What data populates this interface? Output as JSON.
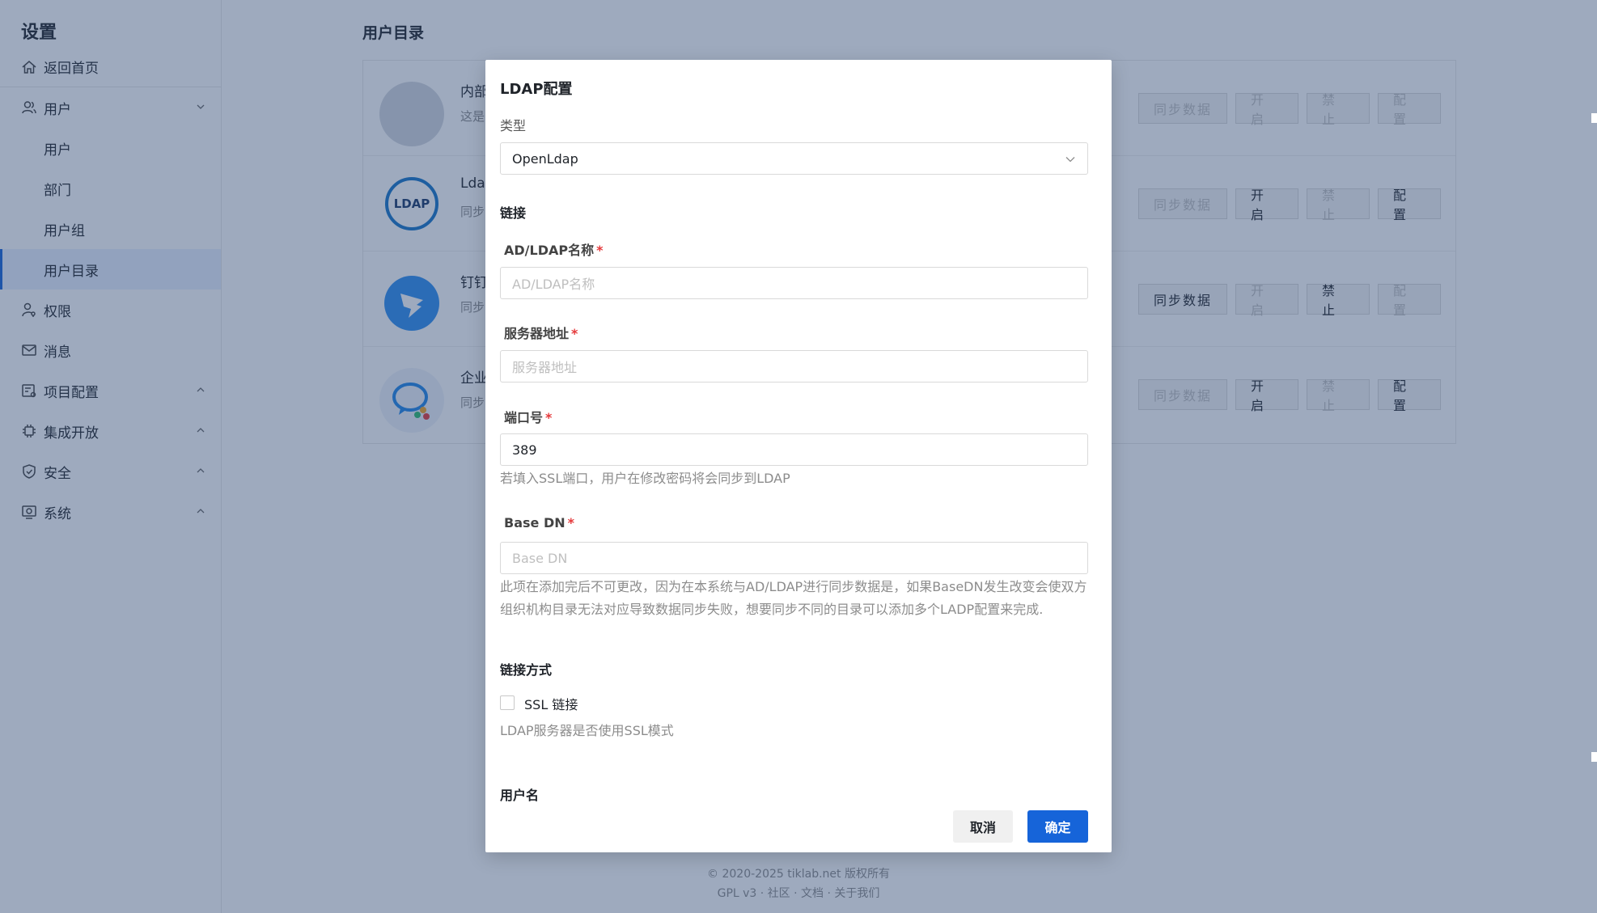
{
  "sidebar": {
    "title": "设置",
    "items": [
      {
        "label": "返回首页",
        "icon": "home-icon"
      },
      {
        "label": "用户",
        "icon": "user-icon",
        "expanded": true
      },
      {
        "label": "用户"
      },
      {
        "label": "部门"
      },
      {
        "label": "用户组"
      },
      {
        "label": "用户目录",
        "active": true
      },
      {
        "label": "权限",
        "icon": "permission-icon"
      },
      {
        "label": "消息",
        "icon": "mail-icon"
      },
      {
        "label": "项目配置",
        "icon": "project-config-icon"
      },
      {
        "label": "集成开放",
        "icon": "chip-icon"
      },
      {
        "label": "安全",
        "icon": "shield-icon"
      },
      {
        "label": "系统",
        "icon": "system-icon"
      }
    ]
  },
  "page": {
    "title": "用户目录"
  },
  "directories": [
    {
      "name": "内部",
      "desc": "这是",
      "logo": "default-avatar",
      "actions": [
        {
          "label": "同步数据",
          "disabled": true
        },
        {
          "label": "开 启",
          "disabled": true
        },
        {
          "label": "禁 止",
          "disabled": true
        },
        {
          "label": "配 置",
          "disabled": true
        }
      ]
    },
    {
      "name": "Ldap",
      "desc": "同步",
      "logo": "ldap-logo",
      "actions": [
        {
          "label": "同步数据",
          "disabled": true
        },
        {
          "label": "开 启",
          "disabled": false
        },
        {
          "label": "禁 止",
          "disabled": true
        },
        {
          "label": "配 置",
          "disabled": false
        }
      ]
    },
    {
      "name": "钉钉",
      "desc": "同步",
      "logo": "dingtalk-logo",
      "actions": [
        {
          "label": "同步数据",
          "disabled": false
        },
        {
          "label": "开 启",
          "disabled": true
        },
        {
          "label": "禁 止",
          "disabled": false
        },
        {
          "label": "配 置",
          "disabled": true
        }
      ]
    },
    {
      "name": "企业",
      "desc": "同步",
      "logo": "wecom-logo",
      "actions": [
        {
          "label": "同步数据",
          "disabled": true
        },
        {
          "label": "开 启",
          "disabled": false
        },
        {
          "label": "禁 止",
          "disabled": true
        },
        {
          "label": "配 置",
          "disabled": false
        }
      ]
    }
  ],
  "footer": {
    "copyright": "© 2020-2025 tiklab.net 版权所有",
    "links": "GPL v3 · 社区 · 文档 · 关于我们"
  },
  "modal": {
    "title": "LDAP配置",
    "type_label": "类型",
    "type_value": "OpenLdap",
    "section_link": "链接",
    "name_label": "AD/LDAP名称",
    "name_placeholder": "AD/LDAP名称",
    "server_label": "服务器地址",
    "server_placeholder": "服务器地址",
    "port_label": "端口号",
    "port_value": "389",
    "port_hint": "若填入SSL端口，用户在修改密码将会同步到LDAP",
    "basedn_label": "Base DN",
    "basedn_placeholder": "Base DN",
    "basedn_hint": "此项在添加完后不可更改，因为在本系统与AD/LDAP进行同步数据是，如果BaseDN发生改变会使双方组织机构目录无法对应导致数据同步失败，想要同步不同的目录可以添加多个LADP配置来完成.",
    "section_conn": "链接方式",
    "ssl_label": "SSL 链接",
    "ssl_checked": false,
    "ssl_hint": "LDAP服务器是否使用SSL模式",
    "section_user": "用户名",
    "cancel_label": "取消",
    "ok_label": "确定",
    "required_mark": "*"
  },
  "colors": {
    "accent": "#1664d9",
    "required": "#e5393b",
    "overlay": "#28426e"
  }
}
